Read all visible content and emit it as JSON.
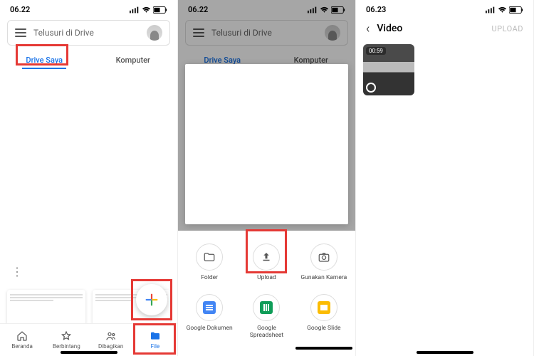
{
  "panel1": {
    "time": "06.22",
    "search_placeholder": "Telusuri di Drive",
    "tabs": {
      "drive": "Drive Saya",
      "computer": "Komputer"
    },
    "nav": {
      "home": "Beranda",
      "starred": "Berbintang",
      "shared": "Dibagikan",
      "file": "File"
    }
  },
  "panel2": {
    "time": "06.22",
    "search_placeholder": "Telusuri di Drive",
    "tabs": {
      "drive": "Drive Saya",
      "computer": "Komputer"
    },
    "actions": {
      "folder": "Folder",
      "upload": "Upload",
      "camera": "Gunakan Kamera",
      "docs": "Google Dokumen",
      "sheets": "Google\nSpreadsheet",
      "slides": "Google Slide"
    }
  },
  "panel3": {
    "time": "06.23",
    "title": "Video",
    "upload_label": "UPLOAD",
    "video": {
      "duration": "00:59"
    }
  }
}
